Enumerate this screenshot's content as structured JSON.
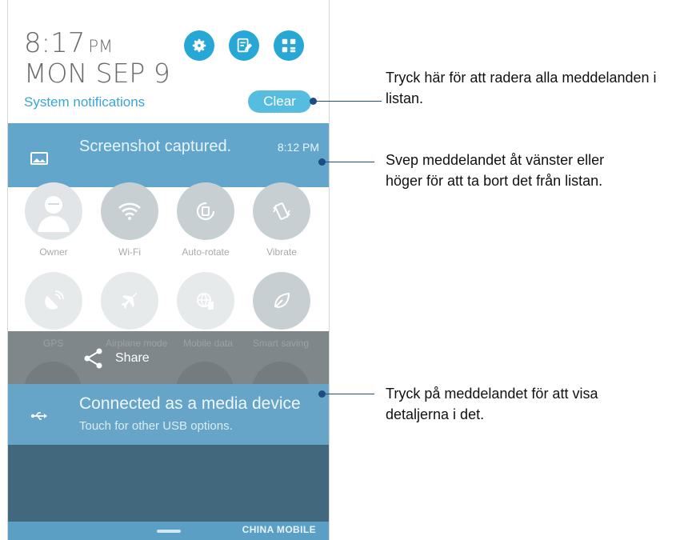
{
  "header": {
    "time": "8:17",
    "ampm": "PM",
    "date": "MON SEP 9",
    "system_notifications": "System notifications",
    "clear_label": "Clear",
    "quick_icons": [
      "gear-icon",
      "edit-icon",
      "grid-icon"
    ]
  },
  "notifications": [
    {
      "title": "Screenshot captured.",
      "time": "8:12 PM",
      "icon": "image-icon"
    },
    {
      "title": "Connected as a media device",
      "subtitle": "Touch for other USB options.",
      "icon": "usb-icon"
    }
  ],
  "quick_settings": {
    "row1": [
      "Owner",
      "Wi-Fi",
      "Auto-rotate",
      "Vibrate"
    ],
    "row2": [
      "GPS",
      "Airplane mode",
      "Mobile data",
      "Smart saving"
    ]
  },
  "share": {
    "label": "Share"
  },
  "status": {
    "carrier": "CHINA MOBILE"
  },
  "callouts": [
    "Tryck här för att radera alla meddelanden i\nlistan.",
    "Svep meddelandet åt vänster eller\nhöger för att ta bort det från listan.",
    "Tryck på meddelandet för att visa\ndetaljerna i det."
  ],
  "colors": {
    "accent": "#27a7d6",
    "notification": "#62a6cc",
    "callout": "#1e4c82"
  }
}
